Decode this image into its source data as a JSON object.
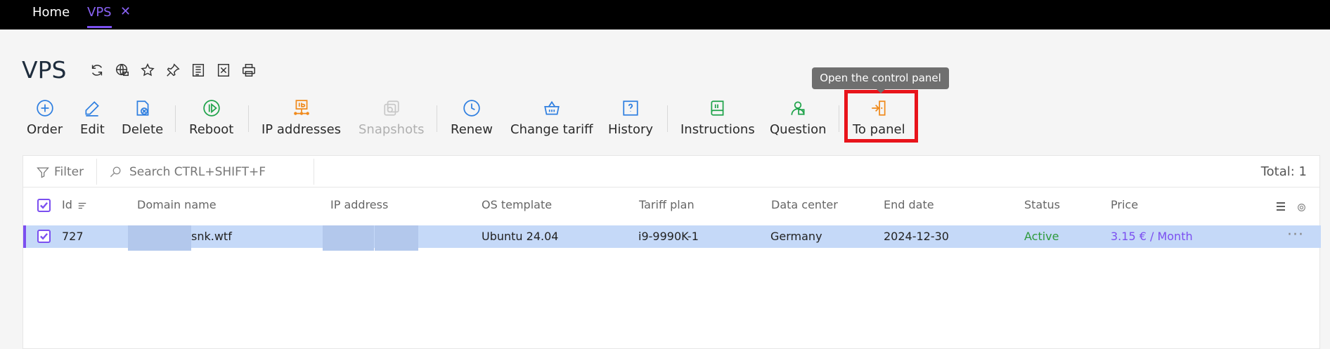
{
  "tabs": {
    "home_label": "Home",
    "vps_label": "VPS",
    "close_glyph": "✕"
  },
  "page": {
    "title": "VPS"
  },
  "header_icons": [
    "refresh-icon",
    "globe-icon",
    "star-icon",
    "pin-icon",
    "list-doc-icon",
    "excel-icon",
    "printer-icon"
  ],
  "toolbar": {
    "order": "Order",
    "edit": "Edit",
    "delete": "Delete",
    "reboot": "Reboot",
    "ip_addresses": "IP addresses",
    "snapshots": "Snapshots",
    "renew": "Renew",
    "change_tariff": "Change tariff",
    "history": "History",
    "instructions": "Instructions",
    "question": "Question",
    "to_panel": "To panel"
  },
  "tooltip": "Open the control panel",
  "filterbar": {
    "filter_label": "Filter",
    "search_placeholder": "Search CTRL+SHIFT+F",
    "total": "Total: 1"
  },
  "columns": {
    "id": "Id",
    "domain": "Domain name",
    "ip": "IP address",
    "os": "OS template",
    "tariff": "Tariff plan",
    "dc": "Data center",
    "end": "End date",
    "status": "Status",
    "price": "Price"
  },
  "rows": [
    {
      "id": "727",
      "domain": "snk.wtf",
      "os": "Ubuntu 24.04",
      "tariff": "i9-9990K-1",
      "dc": "Germany",
      "end": "2024-12-30",
      "status": "Active",
      "price": "3.15 € / Month",
      "more": "···"
    }
  ],
  "colors": {
    "accent": "#7b4ff0",
    "selected_row": "#c5d9f8",
    "status_active": "#2e9a3c",
    "highlight_box": "#e8141b"
  }
}
